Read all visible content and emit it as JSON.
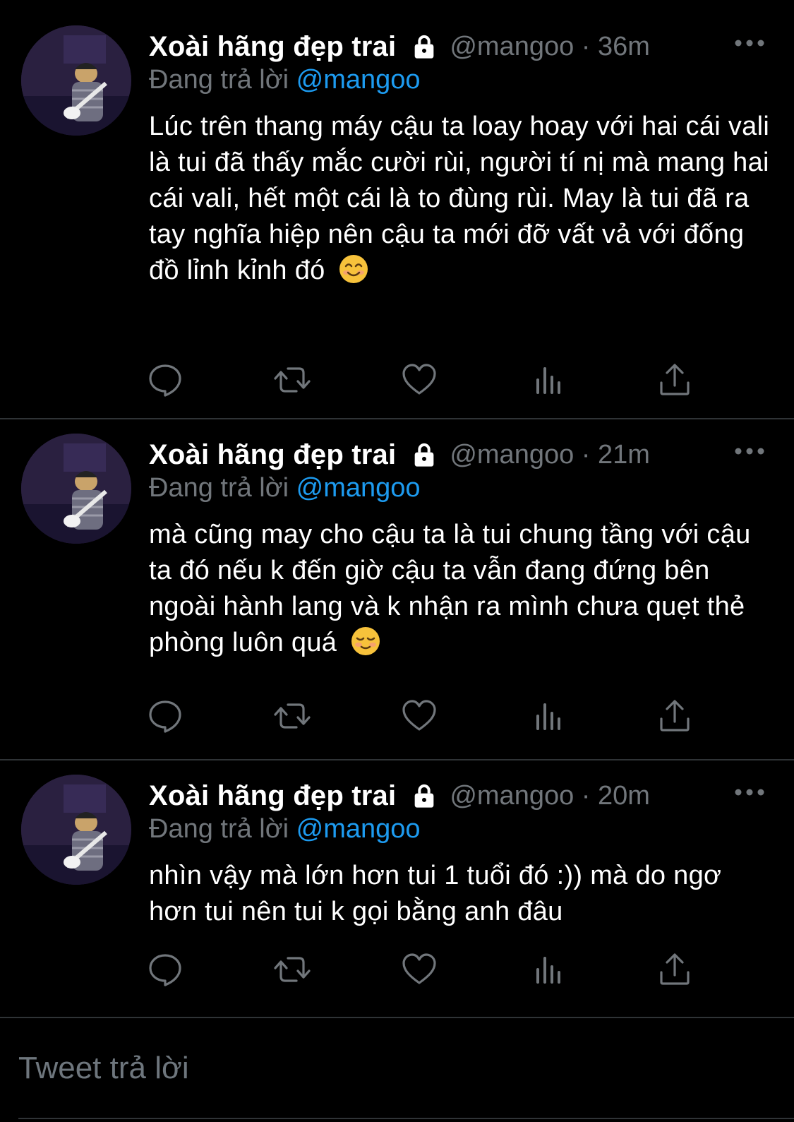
{
  "tweets": [
    {
      "name": "Xoài hãng đẹp trai",
      "handle_time": "@mangoo · 36m",
      "reply_prefix": "Đang trả lời",
      "reply_to": "@mangoo",
      "text": "Lúc trên thang máy cậu ta loay hoay với hai cái vali là tui đã thấy mắc cười rùi, người tí nị mà mang hai cái vali, hết một cái là to đùng rùi. May là tui đã ra tay nghĩa hiệp nên cậu ta mới đỡ vất vả với đống đồ lỉnh kỉnh đó",
      "emoji": "smiling-face-icon"
    },
    {
      "name": "Xoài hãng đẹp trai",
      "handle_time": "@mangoo · 21m",
      "reply_prefix": "Đang trả lời",
      "reply_to": "@mangoo",
      "text": "mà cũng may cho cậu ta là tui chung tầng với cậu ta đó nếu k đến giờ cậu ta vẫn đang đứng bên ngoài hành lang và k nhận ra mình chưa quẹt thẻ phòng luôn quá",
      "emoji": "relieved-face-icon"
    },
    {
      "name": "Xoài hãng đẹp trai",
      "handle_time": "@mangoo · 20m",
      "reply_prefix": "Đang trả lời",
      "reply_to": "@mangoo",
      "text": "nhìn vậy mà lớn hơn tui 1 tuổi đó :)) mà do ngơ hơn tui nên tui k gọi bằng anh đâu",
      "emoji": ""
    }
  ],
  "icons": {
    "lock": "lock-icon",
    "more": "more-icon",
    "reply": "reply-icon",
    "retweet": "retweet-icon",
    "like": "heart-icon",
    "views": "analytics-icon",
    "share": "share-icon"
  },
  "compose": {
    "placeholder": "Tweet trả lời"
  },
  "colors": {
    "background": "#000000",
    "text": "#ffffff",
    "muted": "#71767b",
    "accent": "#1d9bf0",
    "divider": "#2f3336"
  }
}
